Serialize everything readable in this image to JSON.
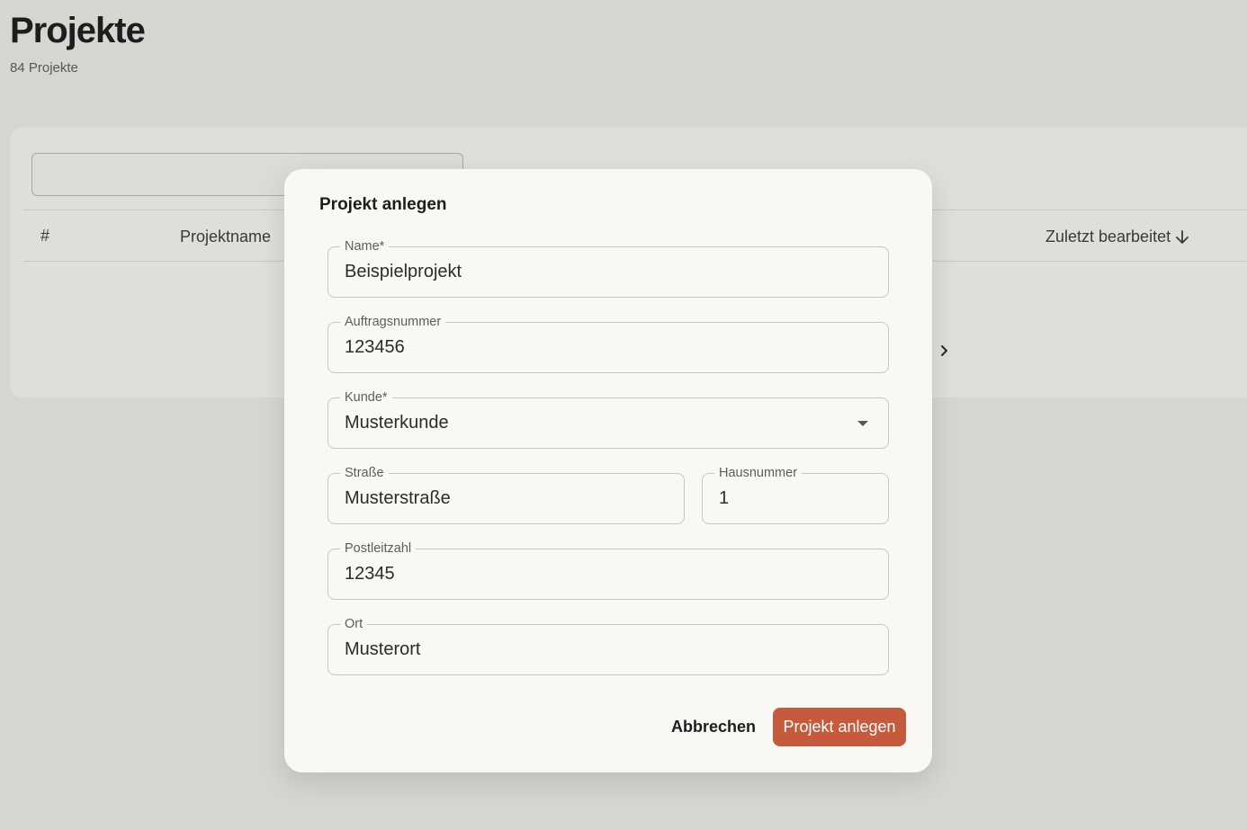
{
  "page": {
    "title": "Projekte",
    "subtitle": "84 Projekte"
  },
  "table": {
    "columns": {
      "number": "#",
      "name": "Projektname",
      "updated": "Zuletzt bearbeitet"
    },
    "sort_icon": "arrow-down-icon",
    "pagination_icon": "chevron-right-icon"
  },
  "dialog": {
    "title": "Projekt anlegen",
    "fields": {
      "name": {
        "label": "Name*",
        "value": "Beispielprojekt"
      },
      "order_number": {
        "label": "Auftragsnummer",
        "value": "123456"
      },
      "customer": {
        "label": "Kunde*",
        "value": "Musterkunde"
      },
      "street": {
        "label": "Straße",
        "value": "Musterstraße"
      },
      "house_number": {
        "label": "Hausnummer",
        "value": "1"
      },
      "postal_code": {
        "label": "Postleitzahl",
        "value": "12345"
      },
      "city": {
        "label": "Ort",
        "value": "Musterort"
      }
    },
    "cancel_label": "Abbrechen",
    "submit_label": "Projekt anlegen"
  },
  "colors": {
    "accent": "#c65a3c",
    "background": "#d6d5d1",
    "dialog": "#f9f8f5"
  }
}
